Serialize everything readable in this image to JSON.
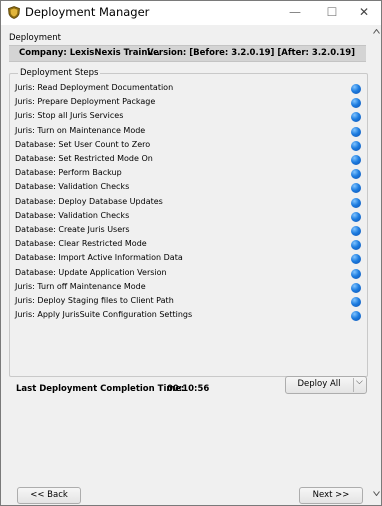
{
  "window": {
    "title": "Deployment Manager",
    "controls": {
      "minimize": "—",
      "maximize": "☐",
      "close": "✕"
    }
  },
  "section_label": "Deployment",
  "info": {
    "company": "Company:  LexisNexis Traini...",
    "version": "Version:  [Before:  3.2.0.19]   [After:  3.2.0.19]"
  },
  "steps": {
    "legend": "Deployment Steps",
    "status_color": "#1e7de0",
    "items": [
      "Juris:  Read Deployment Documentation",
      "Juris:  Prepare Deployment Package",
      "Juris:  Stop all Juris Services",
      "Juris:  Turn on Maintenance Mode",
      "Database:  Set User Count to Zero",
      "Database:  Set Restricted  Mode On",
      "Database:  Perform Backup",
      "Database:  Validation Checks",
      "Database:  Deploy Database Updates",
      "Database:  Validation Checks",
      "Database:  Create Juris Users",
      "Database:  Clear Restricted  Mode",
      "Database:  Import Active Information Data",
      "Database:  Update Application Version",
      "Juris:  Turn off Maintenance Mode",
      "Juris:  Deploy Staging files to Client Path",
      "Juris:  Apply JurisSuite Configuration Settings"
    ]
  },
  "completion": {
    "label": "Last Deployment Completion Time:",
    "value": "00:10:56"
  },
  "deploy_button": {
    "label": "Deploy All",
    "arrow": "⌵"
  },
  "nav": {
    "back": "<< Back",
    "next": "Next >>"
  }
}
